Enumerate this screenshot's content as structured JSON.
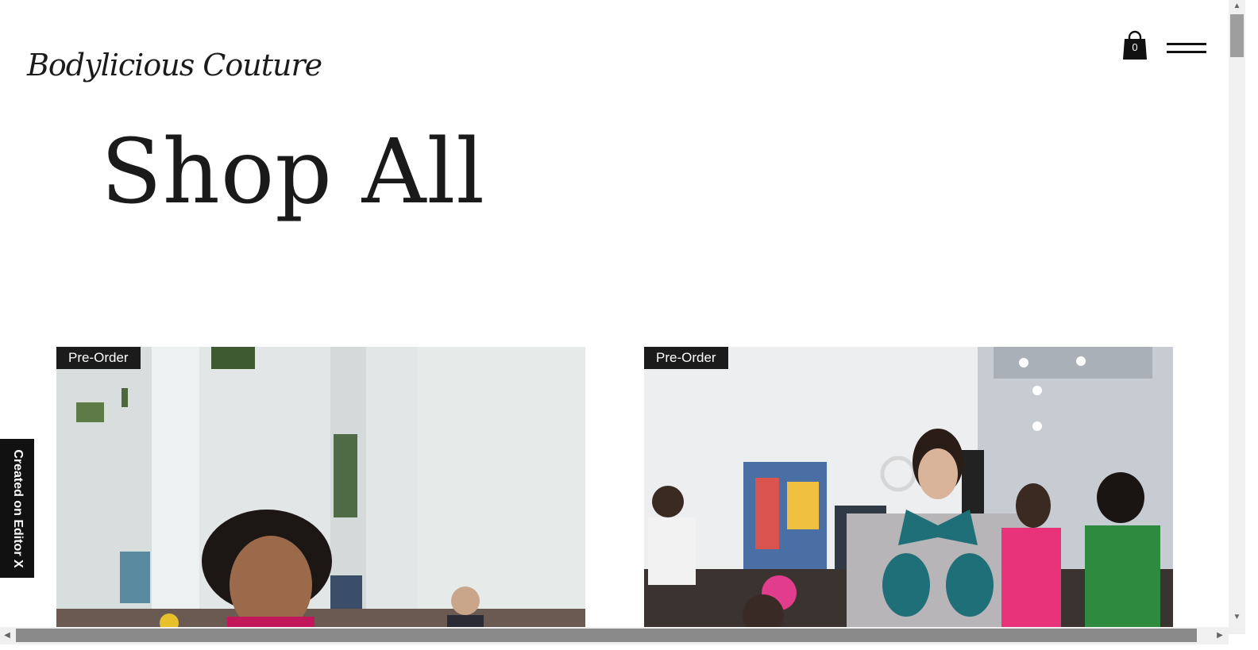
{
  "header": {
    "logo": "Bodylicious Couture",
    "cart_count": "0",
    "cart_icon": "shopping-bag-icon",
    "menu_icon": "hamburger-menu-icon"
  },
  "page": {
    "title": "Shop All"
  },
  "products": [
    {
      "badge": "Pre-Order"
    },
    {
      "badge": "Pre-Order"
    }
  ],
  "editor_badge": {
    "label": "Created on Editor X"
  },
  "colors": {
    "text": "#1a1a1a",
    "badge_bg": "#1b1b1b",
    "badge_text": "#ffffff"
  }
}
